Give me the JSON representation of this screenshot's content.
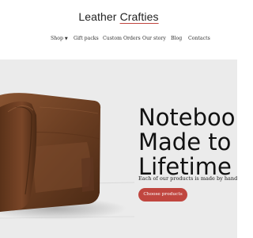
{
  "header": {
    "logo_part1": "Leather",
    "logo_part2": "Crafties"
  },
  "nav": {
    "items": [
      {
        "label": "Shop"
      },
      {
        "label": "Gift packs"
      },
      {
        "label": "Custom Orders"
      },
      {
        "label": "Our story"
      },
      {
        "label": "Blog"
      },
      {
        "label": "Contacts"
      }
    ],
    "shop_caret_icon": "chevron-down-icon"
  },
  "hero": {
    "headline_line1": "Notebook",
    "headline_line2": "Made to La",
    "headline_line3": "Lifetime",
    "tagline": "Each of our products is made by hand from th",
    "cta_label": "Choose products",
    "image": "leather-notebook-photo"
  },
  "colors": {
    "accent": "#c0463f",
    "hero_background": "#ebebeb",
    "leather": "#6b3e22",
    "text": "#111111"
  }
}
